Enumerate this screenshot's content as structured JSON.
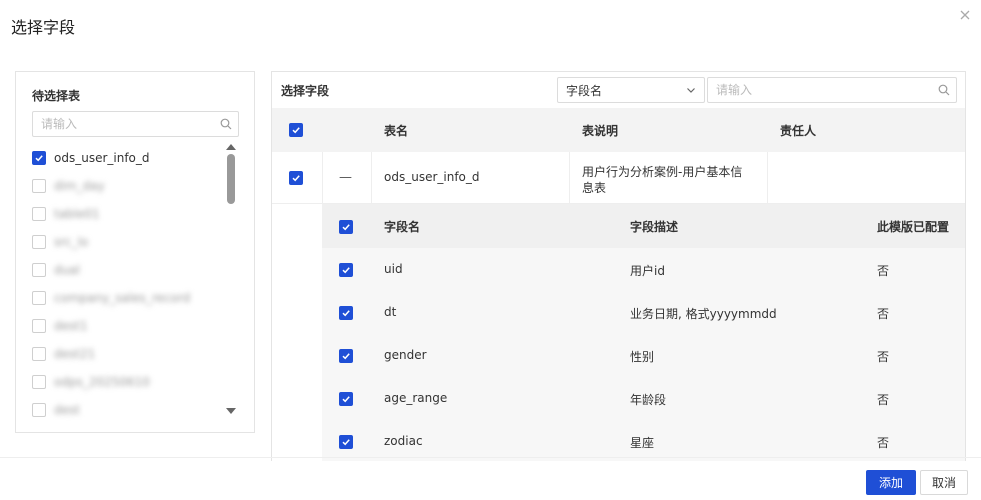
{
  "dialog": {
    "title": "选择字段"
  },
  "colors": {
    "accent": "#1f4fd6",
    "header_bg": "#f3f3f3",
    "sub_bg": "#f7f7f7"
  },
  "left": {
    "title": "待选择表",
    "search_placeholder": "请输入",
    "items": [
      {
        "label": "ods_user_info_d",
        "checked": true,
        "blurred": false
      },
      {
        "label": "dim_day",
        "checked": false,
        "blurred": true
      },
      {
        "label": "table01",
        "checked": false,
        "blurred": true
      },
      {
        "label": "src_lo",
        "checked": false,
        "blurred": true
      },
      {
        "label": "dual",
        "checked": false,
        "blurred": true
      },
      {
        "label": "company_sales_record",
        "checked": false,
        "blurred": true
      },
      {
        "label": "dest1",
        "checked": false,
        "blurred": true
      },
      {
        "label": "dest21",
        "checked": false,
        "blurred": true
      },
      {
        "label": "odps_20250610",
        "checked": false,
        "blurred": true
      },
      {
        "label": "dest",
        "checked": false,
        "blurred": true
      }
    ]
  },
  "right": {
    "title": "选择字段",
    "select_value": "字段名",
    "search_placeholder": "请输入",
    "columns": [
      "表名",
      "表说明",
      "责任人"
    ],
    "table_row": {
      "expand_symbol": "—",
      "name": "ods_user_info_d",
      "desc_line1": "用户行为分析案例-用户基本信",
      "desc_line2": "息表",
      "owner": ""
    },
    "sub_columns": [
      "字段名",
      "字段描述",
      "此模版已配置"
    ],
    "fields": [
      {
        "name": "uid",
        "desc": "用户id",
        "configured": "否"
      },
      {
        "name": "dt",
        "desc": "业务日期, 格式yyyymmdd",
        "configured": "否"
      },
      {
        "name": "gender",
        "desc": "性别",
        "configured": "否"
      },
      {
        "name": "age_range",
        "desc": "年龄段",
        "configured": "否"
      },
      {
        "name": "zodiac",
        "desc": "星座",
        "configured": "否"
      }
    ]
  },
  "footer": {
    "add_label": "添加",
    "cancel_label": "取消"
  }
}
